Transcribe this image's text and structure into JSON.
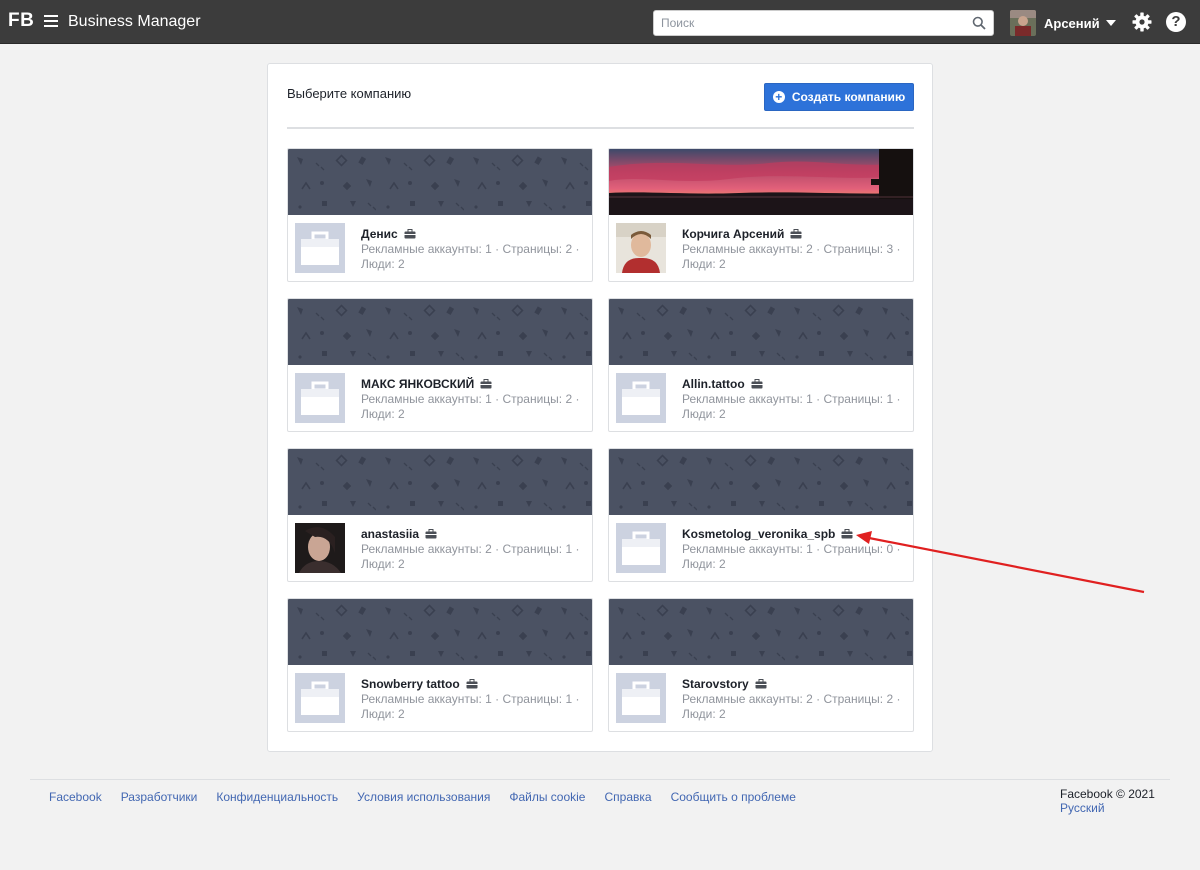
{
  "topbar": {
    "brand": "FB",
    "app_title": "Business Manager",
    "search_placeholder": "Поиск",
    "user_name": "Арсений"
  },
  "panel": {
    "title": "Выберите компанию",
    "create_button": "Создать компанию"
  },
  "businesses": [
    {
      "name": "Денис",
      "line1": "Рекламные аккаунты: 1 · Страницы: 2 ·",
      "line2": "Люди: 2",
      "cover": "pattern",
      "avatar": "default"
    },
    {
      "name": "Корчига Арсений",
      "line1": "Рекламные аккаунты: 2 · Страницы: 3 ·",
      "line2": "Люди: 2",
      "cover": "sunset-photo",
      "avatar": "photo"
    },
    {
      "name": "МАКС ЯНКОВСКИЙ",
      "line1": "Рекламные аккаунты: 1 · Страницы: 2 ·",
      "line2": "Люди: 2",
      "cover": "pattern",
      "avatar": "default"
    },
    {
      "name": "Allin.tattoo",
      "line1": "Рекламные аккаунты: 1 · Страницы: 1 ·",
      "line2": "Люди: 2",
      "cover": "pattern",
      "avatar": "default"
    },
    {
      "name": "anastasiia",
      "line1": "Рекламные аккаунты: 2 · Страницы: 1 ·",
      "line2": "Люди: 2",
      "cover": "pattern",
      "avatar": "photo"
    },
    {
      "name": "Kosmetolog_veronika_spb",
      "line1": "Рекламные аккаунты: 1 · Страницы: 0 ·",
      "line2": "Люди: 2",
      "cover": "pattern",
      "avatar": "default"
    },
    {
      "name": "Snowberry tattoo",
      "line1": "Рекламные аккаунты: 1 · Страницы: 1 ·",
      "line2": "Люди: 2",
      "cover": "pattern",
      "avatar": "default"
    },
    {
      "name": "Starovstory",
      "line1": "Рекламные аккаунты: 2 · Страницы: 2 ·",
      "line2": "Люди: 2",
      "cover": "pattern",
      "avatar": "default"
    }
  ],
  "footer": {
    "links": [
      "Facebook",
      "Разработчики",
      "Конфиденциальность",
      "Условия использования",
      "Файлы cookie",
      "Справка",
      "Сообщить о проблеме"
    ],
    "copyright": "Facebook © 2021",
    "language": "Русский"
  },
  "colors": {
    "topbar": "#3c3c3c",
    "accent": "#2d72d9",
    "cover": "#4b5263",
    "annotation_arrow": "#e02020"
  },
  "icons": [
    "menu-icon",
    "search-icon",
    "caret-down-icon",
    "gear-icon",
    "help-icon",
    "plus-icon",
    "briefcase-icon"
  ]
}
